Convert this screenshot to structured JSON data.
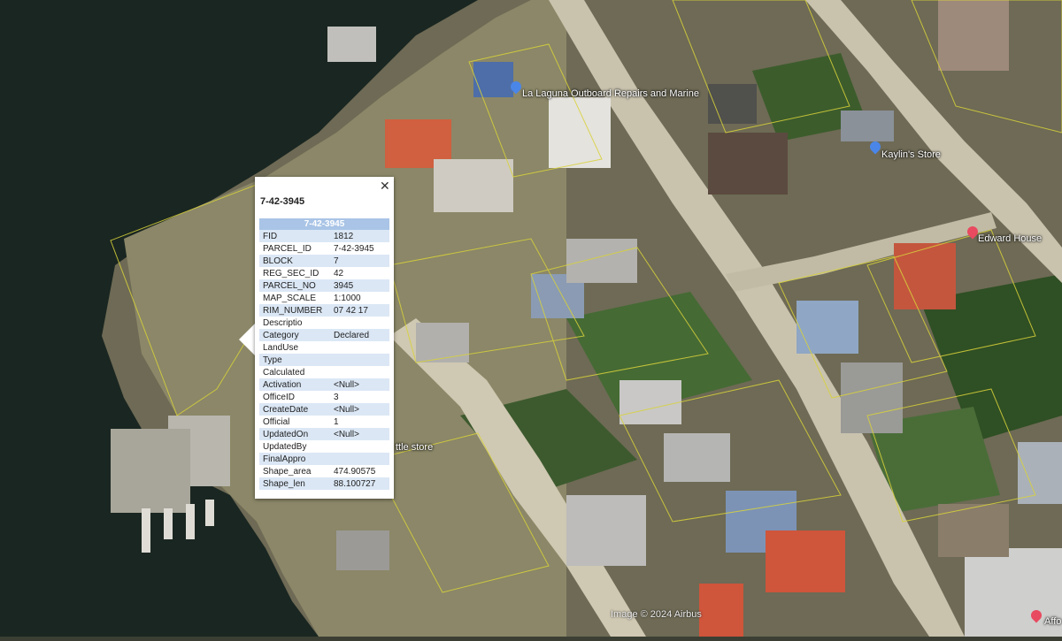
{
  "map": {
    "places": [
      {
        "name": "La Laguna Outboard Repairs and Marine",
        "pin": "blue"
      },
      {
        "name": "Kaylin's Store",
        "pin": "blue"
      },
      {
        "name": "Edward House",
        "pin": "red"
      },
      {
        "name": "ttle store",
        "pin": "none"
      },
      {
        "name": "Affo",
        "pin": "red"
      }
    ],
    "attribution": "Image © 2024 Airbus"
  },
  "popup": {
    "title": "7-42-3945",
    "close_glyph": "✕",
    "table_header": "7-42-3945",
    "rows": [
      {
        "key": "FID",
        "value": "1812"
      },
      {
        "key": "PARCEL_ID",
        "value": "7-42-3945"
      },
      {
        "key": "BLOCK",
        "value": "7"
      },
      {
        "key": "REG_SEC_ID",
        "value": "42"
      },
      {
        "key": "PARCEL_NO",
        "value": "3945"
      },
      {
        "key": "MAP_SCALE",
        "value": "1:1000"
      },
      {
        "key": "RIM_NUMBER",
        "value": "07 42 17"
      },
      {
        "key": "Descriptio",
        "value": ""
      },
      {
        "key": "Category",
        "value": "Declared"
      },
      {
        "key": "LandUse",
        "value": ""
      },
      {
        "key": "Type",
        "value": ""
      },
      {
        "key": "Calculated",
        "value": ""
      },
      {
        "key": "Activation",
        "value": "<Null>"
      },
      {
        "key": "OfficeID",
        "value": "3"
      },
      {
        "key": "CreateDate",
        "value": "<Null>"
      },
      {
        "key": "Official",
        "value": "1"
      },
      {
        "key": "UpdatedOn",
        "value": "<Null>"
      },
      {
        "key": "UpdatedBy",
        "value": ""
      },
      {
        "key": "FinalAppro",
        "value": ""
      },
      {
        "key": "Shape_area",
        "value": "474.90575"
      },
      {
        "key": "Shape_len",
        "value": "88.100727"
      }
    ]
  },
  "colors": {
    "water": "#1a2621",
    "table_header": "#a9c4e6",
    "row_alt": "#dbe7f5",
    "parcel_line": "#d8d23a"
  }
}
